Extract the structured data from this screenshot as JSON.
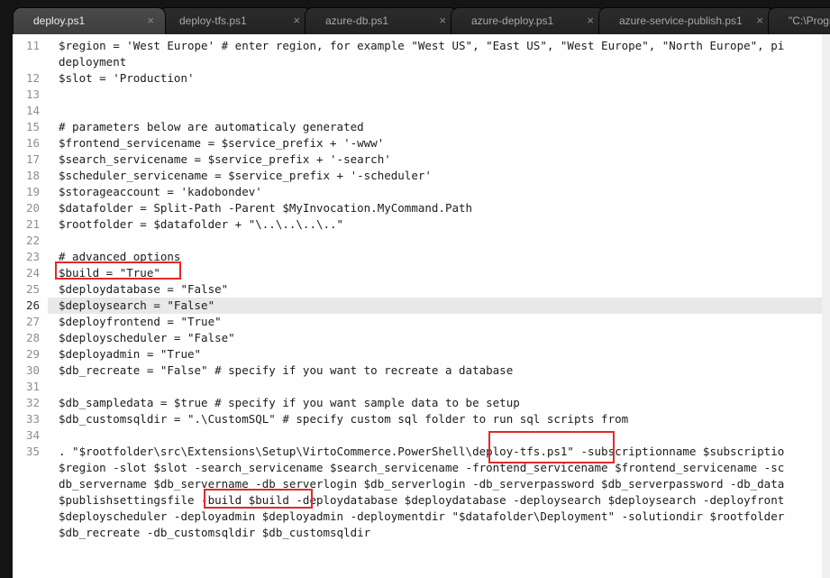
{
  "tabs": [
    {
      "label": "deploy.ps1",
      "close": "×",
      "active": true
    },
    {
      "label": "deploy-tfs.ps1",
      "close": "×",
      "active": false
    },
    {
      "label": "azure-db.ps1",
      "close": "×",
      "active": false
    },
    {
      "label": "azure-deploy.ps1",
      "close": "×",
      "active": false
    },
    {
      "label": "azure-service-publish.ps1",
      "close": "×",
      "active": false
    },
    {
      "label": "\"C:\\Progr",
      "close": "",
      "active": false
    }
  ],
  "editor": {
    "current_line": "26",
    "lines": [
      {
        "num": "11",
        "text": "$region = 'West Europe' # enter region, for example \"West US\", \"East US\", \"West Europe\", \"North Europe\", pi"
      },
      {
        "num": "",
        "text": "deployment"
      },
      {
        "num": "12",
        "text": "$slot = 'Production'"
      },
      {
        "num": "13",
        "text": ""
      },
      {
        "num": "14",
        "text": ""
      },
      {
        "num": "15",
        "text": "# parameters below are automaticaly generated"
      },
      {
        "num": "16",
        "text": "$frontend_servicename = $service_prefix + '-www'"
      },
      {
        "num": "17",
        "text": "$search_servicename = $service_prefix + '-search'"
      },
      {
        "num": "18",
        "text": "$scheduler_servicename = $service_prefix + '-scheduler'"
      },
      {
        "num": "19",
        "text": "$storageaccount = 'kadobondev'"
      },
      {
        "num": "20",
        "text": "$datafolder = Split-Path -Parent $MyInvocation.MyCommand.Path"
      },
      {
        "num": "21",
        "text": "$rootfolder = $datafolder + \"\\..\\..\\..\\..\""
      },
      {
        "num": "22",
        "text": ""
      },
      {
        "num": "23",
        "text": "# advanced options"
      },
      {
        "num": "24",
        "text": "$build = \"True\""
      },
      {
        "num": "25",
        "text": "$deploydatabase = \"False\""
      },
      {
        "num": "26",
        "text": "$deploysearch = \"False\""
      },
      {
        "num": "27",
        "text": "$deployfrontend = \"True\""
      },
      {
        "num": "28",
        "text": "$deployscheduler = \"False\""
      },
      {
        "num": "29",
        "text": "$deployadmin = \"True\""
      },
      {
        "num": "30",
        "text": "$db_recreate = \"False\" # specify if you want to recreate a database"
      },
      {
        "num": "31",
        "text": ""
      },
      {
        "num": "32",
        "text": "$db_sampledata = $true # specify if you want sample data to be setup"
      },
      {
        "num": "33",
        "text": "$db_customsqldir = \".\\CustomSQL\" # specify custom sql folder to run sql scripts from"
      },
      {
        "num": "34",
        "text": ""
      },
      {
        "num": "35",
        "text": ". \"$rootfolder\\src\\Extensions\\Setup\\VirtoCommerce.PowerShell\\deploy-tfs.ps1\" -subscriptionname $subscriptio"
      },
      {
        "num": "",
        "text": "$region -slot $slot -search_servicename $search_servicename -frontend_servicename $frontend_servicename -sc"
      },
      {
        "num": "",
        "text": "db_servername $db_servername -db_serverlogin $db_serverlogin -db_serverpassword $db_serverpassword -db_data"
      },
      {
        "num": "",
        "text": "$publishsettingsfile -build $build -deploydatabase $deploydatabase -deploysearch $deploysearch -deployfront"
      },
      {
        "num": "",
        "text": "$deployscheduler -deployadmin $deployadmin -deploymentdir \"$datafolder\\Deployment\" -solutiondir $rootfolder"
      },
      {
        "num": "",
        "text": "$db_recreate -db_customsqldir $db_customsqldir"
      }
    ]
  },
  "colors": {
    "highlight_box": "#e02a2a",
    "editor_bg": "#fefefe",
    "tab_bar_bg": "#141414",
    "current_line_bg": "#e8e8e8"
  }
}
